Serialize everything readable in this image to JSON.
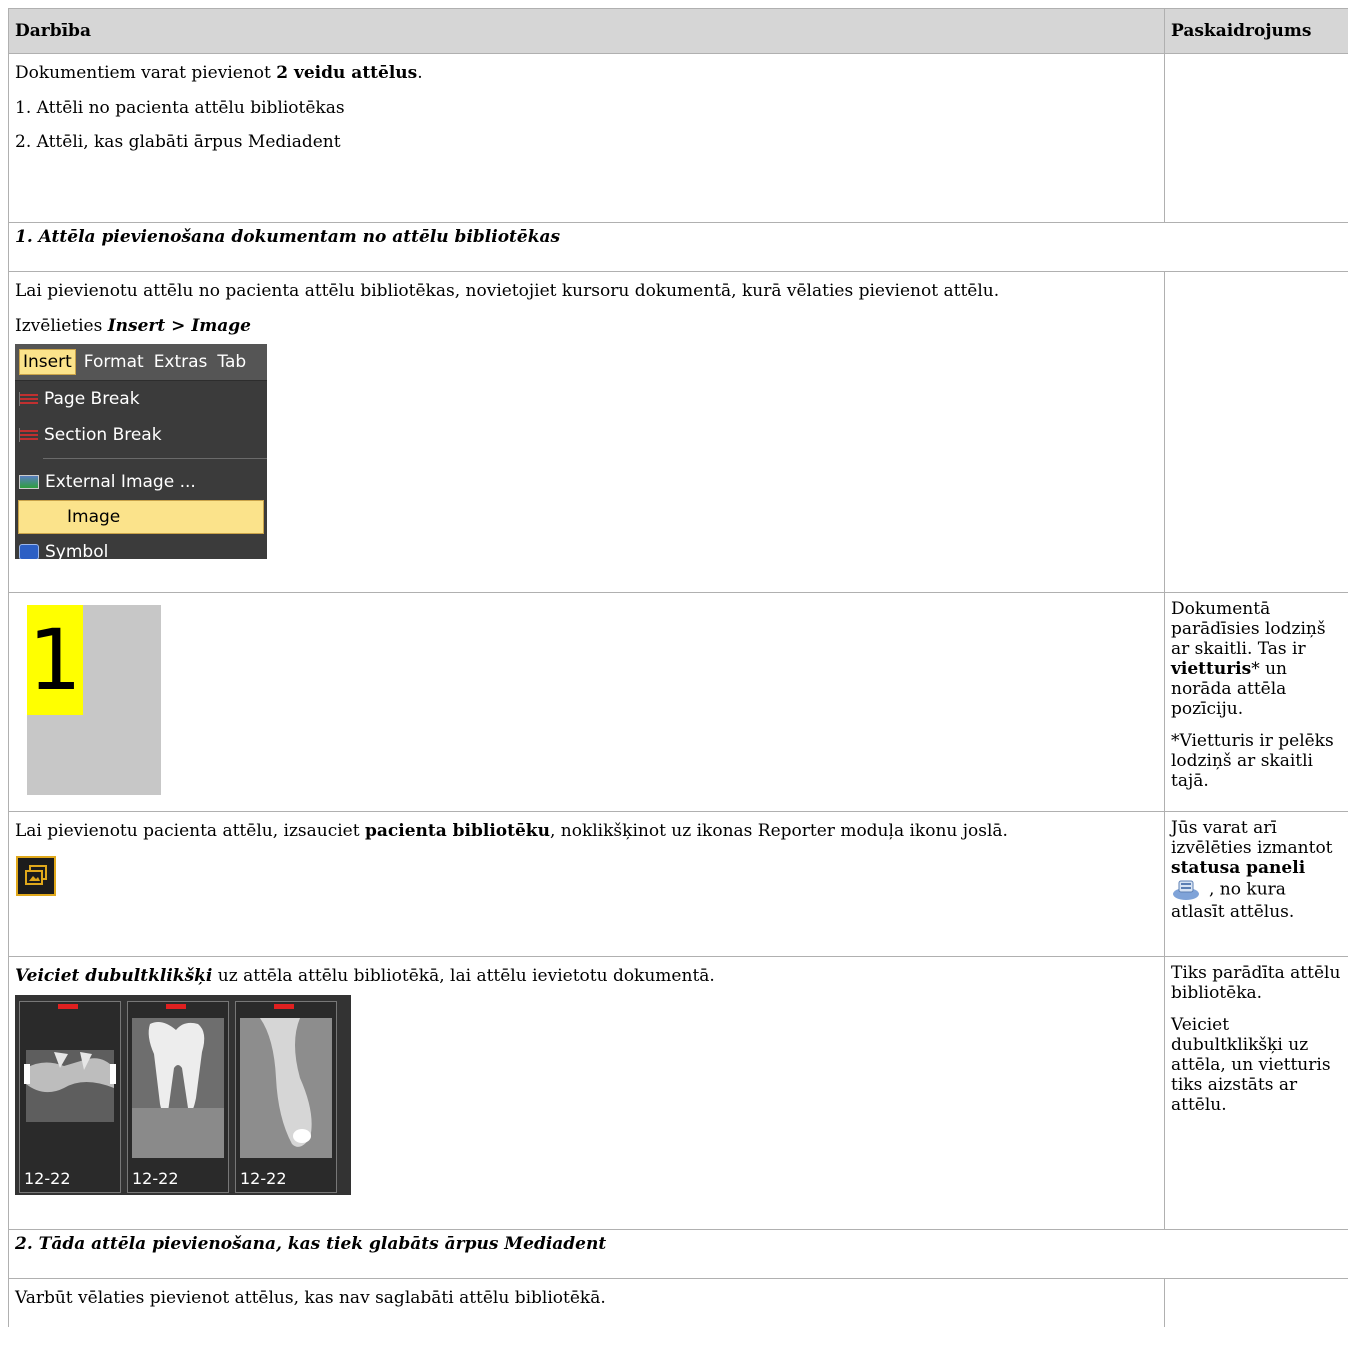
{
  "table": {
    "col_action": "Darbība",
    "col_explanation": "Paskaidrojums"
  },
  "intro": {
    "line1_pre": "Dokumentiem varat pievienot ",
    "line1_bold": "2 veidu attēlus",
    "line1_post": ".",
    "item1": "1. Attēli no pacienta attēlu bibliotēkas",
    "item2": "2. Attēli, kas glabāti ārpus Mediadent"
  },
  "section1": {
    "title": "1. Attēla pievienošana dokumentam no attēlu bibliotēkas"
  },
  "step_cursor": {
    "text": "Lai pievienotu attēlu no pacienta attēlu bibliotēkas, novietojiet kursoru dokumentā, kurā vēlaties pievienot attēlu.",
    "choose_pre": "Izvēlieties ",
    "choose_bold": "Insert > Image"
  },
  "menu": {
    "bar": [
      "Insert",
      "Format",
      "Extras",
      "Tab"
    ],
    "items": [
      "Page Break",
      "Section Break",
      "External Image ...",
      "Image",
      "Symbol"
    ]
  },
  "placeholder": {
    "number": "1",
    "side_p1_pre": "Dokumentā parādīsies lodziņš ar skaitli. Tas ir ",
    "side_p1_bold": "vietturis",
    "side_p1_post": "* un norāda attēla pozīciju.",
    "side_p2": "*Vietturis ir pelēks lodziņš ar skaitli tajā."
  },
  "step_library": {
    "pre": "Lai pievienotu pacienta attēlu, izsauciet ",
    "bold": "pacienta bibliotēku",
    "post": ", noklikšķinot uz ikonas Reporter moduļa ikonu joslā.",
    "side_pre": "Jūs varat arī izvēlēties izmantot ",
    "side_bold": "statusa paneli",
    "side_post": ", no kura atlasīt attēlus."
  },
  "step_dblclick": {
    "bold": "Veiciet dubultklikšķi",
    "post": " uz attēla attēlu bibliotēkā, lai attēlu ievietotu dokumentā.",
    "side_p1": "Tiks parādīta attēlu bibliotēka.",
    "side_p2": "Veiciet dubultklikšķi uz attēla, un vietturis tiks aizstāts ar attēlu.",
    "thumb_labels": [
      "12-22",
      "12-22",
      "12-22"
    ]
  },
  "section2": {
    "title": "2. Tāda attēla pievienošana, kas tiek glabāts ārpus Mediadent"
  },
  "step_external": {
    "text": "Varbūt vēlaties pievienot attēlus, kas nav saglabāti attēlu bibliotēkā."
  }
}
